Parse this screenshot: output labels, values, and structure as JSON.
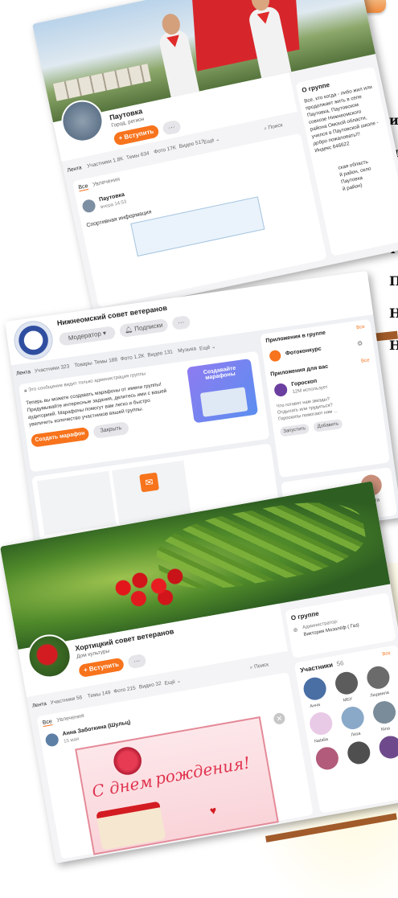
{
  "side_text": [
    "и",
    "и",
    "у",
    "м",
    "т",
    "П",
    "Н",
    "Н"
  ],
  "card1": {
    "group_name": "Паутовка",
    "subtitle": "Город, регион",
    "join": "+ Вступить",
    "more": "···",
    "tabs": [
      "Лента",
      "Участники 1.8K",
      "Темы 634",
      "Фото 17K",
      "Видео 517",
      "Ещё ⌄"
    ],
    "search": "Поиск",
    "filter_all": "Все",
    "filter_hobby": "Увлечения",
    "post_author": "Паутовка",
    "post_time": "вчера 14:53",
    "post_text": "Спортивная информация",
    "about_title": "О группе",
    "about_text": [
      "Все, кто когда - либо жил или",
      "продолжает жить в селе",
      "Паутовка, Паутовском",
      "совхозе Нижнеомского",
      "района Омской области,",
      "учился в Паутовской школе -",
      "добро пожаловать!!!"
    ],
    "index": "Индекс 646622",
    "region_lines": [
      "ская область",
      "й район, село",
      "Паутовка",
      "й район)"
    ]
  },
  "card2": {
    "group_name": "Нижнеомский совет ветеранов",
    "moderator": "Модератор ▾",
    "subscribed": "Подписки",
    "more": "···",
    "tabs": [
      "Лента",
      "Участники 323",
      "Товары",
      "Темы 188",
      "Фото 1.2K",
      "Видео 131",
      "Музыка",
      "Ещё ⌄"
    ],
    "notice": "Это сообщение видит только администрация группы",
    "marathon_text": [
      "Теперь вы можете создавать марафоны от имени группы!",
      "Придумывайте интересные задания, делитесь ими с вашей",
      "аудиторией. Марафоны помогут вам легко и быстро",
      "увеличить количество участников вашей группы."
    ],
    "create_btn": "Создать марафон",
    "close_btn": "Закрыть",
    "promo_title": "Создавайте марафоны",
    "apps_group_title": "Приложения в группе",
    "apps_all": "Все",
    "photo_contest": "Фотоконкурс",
    "apps_you_title": "Приложения для вас",
    "horoscope": "Гороскоп",
    "horoscope_users": "12М использует",
    "horoscope_desc": [
      "Что готовят нам звезды?",
      "Отдыхать или трудиться?",
      "Гороскопы помогают нам ..."
    ],
    "launch": "Запустить",
    "add": "Добавить",
    "member_name": "Ольга"
  },
  "card3": {
    "group_name": "Хортицкий совет ветеранов",
    "subtitle": "Дом культуры",
    "join": "+ Вступить",
    "more": "···",
    "tabs": [
      "Лента",
      "Участники 56",
      "Темы 149",
      "Фото 215",
      "Видео 32",
      "Ещё ⌄"
    ],
    "search": "Поиск",
    "filter_all": "Все",
    "filter_hobby": "Увлечения",
    "post_author": "Анна Заботкина (Шульц)",
    "post_time": "15 мая",
    "card_greeting_1": "С днем",
    "card_greeting_2": "рождения!",
    "about_title": "О группе",
    "admin_label": "Администратор:",
    "admin_name": "Виктория Мозолёф ( Газ)",
    "members_title": "Участники",
    "members_count": "56",
    "members_all": "Все",
    "members": [
      "Анна",
      "МБУ",
      "Людмила",
      "Natalia",
      "Лиза",
      "Nina"
    ]
  },
  "colors": {
    "accent": "#f7731c",
    "brand_bar": "#a15b2a",
    "tab_orange": "#f08c3e"
  }
}
